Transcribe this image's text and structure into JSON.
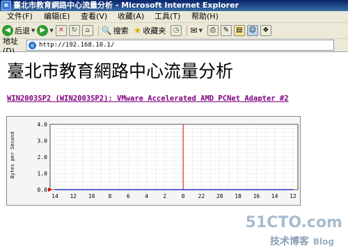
{
  "window": {
    "title": "臺北市教育網路中心流量分析 - Microsoft Internet Explorer"
  },
  "menu": {
    "items": [
      "文件(F)",
      "编辑(E)",
      "查看(V)",
      "收藏(A)",
      "工具(T)",
      "帮助(H)"
    ]
  },
  "toolbar": {
    "back_label": "后退",
    "search_label": "搜索",
    "favorites_label": "收藏夹"
  },
  "address": {
    "label": "地址(D)",
    "url": "http://192.168.10.1/"
  },
  "page": {
    "title": "臺北市教育網路中心流量分析",
    "interface_link": "WIN2003SP2 (WIN2003SP2): VMware Accelerated AMD PCNet Adapter #2"
  },
  "chart_data": {
    "type": "line",
    "ylabel": "Bytes per Second",
    "ylim": [
      0,
      4.0
    ],
    "y_ticks": [
      "4.0",
      "3.0",
      "2.0",
      "1.0",
      "0.0"
    ],
    "x_ticks": [
      "14",
      "12",
      "10",
      "8",
      "6",
      "4",
      "2",
      "0",
      "22",
      "20",
      "18",
      "16",
      "14",
      "12"
    ],
    "current_marker_tick": "0",
    "series": [
      {
        "values": [
          0,
          0,
          0,
          0,
          0,
          0,
          0,
          0,
          0,
          0,
          0,
          0,
          0,
          0
        ]
      }
    ],
    "grid": true
  },
  "watermark": {
    "site": "51CTO.com",
    "line2_a": "技术博客",
    "line2_b": "Blog"
  }
}
